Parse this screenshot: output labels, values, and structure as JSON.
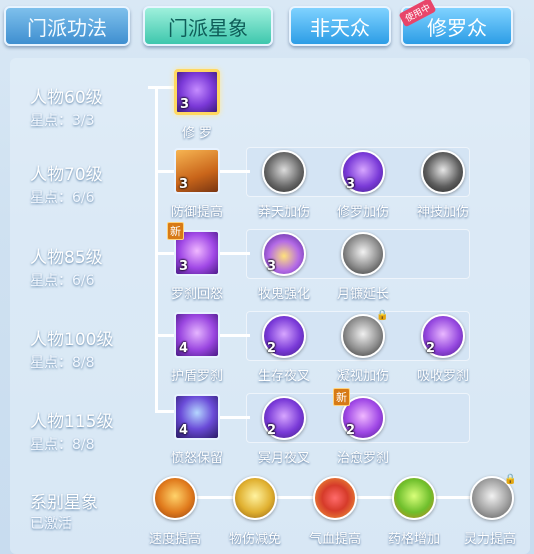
{
  "tabs": [
    {
      "label": "门派功法"
    },
    {
      "label": "门派星象"
    },
    {
      "label": "非天众"
    },
    {
      "label": "修罗众",
      "ribbon": "使用中"
    }
  ],
  "rows": [
    {
      "level": "人物60级",
      "stars": "星点：3/3"
    },
    {
      "level": "人物70级",
      "stars": "星点：6/6"
    },
    {
      "level": "人物85级",
      "stars": "星点：6/6"
    },
    {
      "level": "人物100级",
      "stars": "星点：8/8"
    },
    {
      "level": "人物115级",
      "stars": "星点：8/8"
    }
  ],
  "skills": {
    "r1": [
      {
        "name": "修 罗",
        "lvl": "3"
      }
    ],
    "r2": [
      {
        "name": "防御提高",
        "lvl": "3"
      },
      {
        "name": "莽天加伤",
        "lvl": ""
      },
      {
        "name": "修罗加伤",
        "lvl": "3"
      },
      {
        "name": "神技加伤",
        "lvl": ""
      }
    ],
    "r3": [
      {
        "name": "罗刹回怒",
        "lvl": "3",
        "new": "新"
      },
      {
        "name": "牧鬼强化",
        "lvl": "3"
      },
      {
        "name": "月镰延长",
        "lvl": ""
      }
    ],
    "r4": [
      {
        "name": "护盾罗刹",
        "lvl": "4"
      },
      {
        "name": "生存夜叉",
        "lvl": "2"
      },
      {
        "name": "凝视加伤",
        "lvl": ""
      },
      {
        "name": "吸收罗刹",
        "lvl": "2"
      }
    ],
    "r5": [
      {
        "name": "愤怒保留",
        "lvl": "4"
      },
      {
        "name": "冥月夜叉",
        "lvl": "2"
      },
      {
        "name": "治愈罗刹",
        "lvl": "2",
        "new": "新"
      }
    ]
  },
  "series": {
    "title": "系别星象",
    "status": "已激活",
    "items": [
      {
        "name": "速度提高"
      },
      {
        "name": "物伤减免"
      },
      {
        "name": "气血提高"
      },
      {
        "name": "药格增加"
      },
      {
        "name": "灵力提高"
      }
    ]
  },
  "colors": {
    "accent": "#3ec7ad",
    "tab_blue": "#2c9de6",
    "gold": "#ffd861"
  }
}
